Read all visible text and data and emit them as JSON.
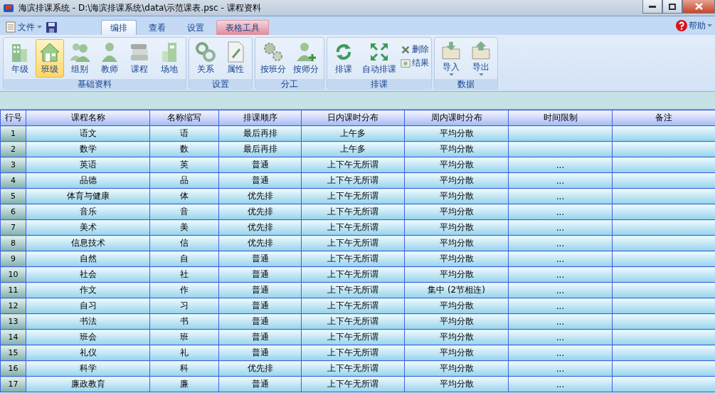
{
  "window": {
    "title": "海滨排课系统 - D:\\海滨排课系统\\data\\示范课表.psc - 课程资料"
  },
  "file_menu": {
    "label": "文件"
  },
  "help_menu": {
    "label": "帮助"
  },
  "tabs": [
    {
      "label": "编排",
      "selected": true,
      "kind": "normal"
    },
    {
      "label": "查看",
      "selected": false,
      "kind": "normal"
    },
    {
      "label": "设置",
      "selected": false,
      "kind": "normal"
    },
    {
      "label": "表格工具",
      "selected": false,
      "kind": "contextual"
    }
  ],
  "ribbon_groups": [
    {
      "title": "基础资料",
      "buttons": [
        {
          "label": "年级",
          "kind": "large",
          "selected": false
        },
        {
          "label": "班级",
          "kind": "large",
          "selected": true
        },
        {
          "label": "组别",
          "kind": "large",
          "selected": false
        },
        {
          "label": "教师",
          "kind": "large",
          "selected": false
        },
        {
          "label": "课程",
          "kind": "large",
          "selected": false
        },
        {
          "label": "场地",
          "kind": "large",
          "selected": false
        }
      ]
    },
    {
      "title": "设置",
      "buttons": [
        {
          "label": "关系",
          "kind": "large",
          "selected": false
        },
        {
          "label": "属性",
          "kind": "large",
          "selected": false
        }
      ]
    },
    {
      "title": "分工",
      "buttons": [
        {
          "label": "按班分",
          "kind": "large",
          "selected": false
        },
        {
          "label": "按师分",
          "kind": "large",
          "selected": false
        }
      ]
    },
    {
      "title": "排课",
      "buttons": [
        {
          "label": "排课",
          "kind": "large",
          "selected": false
        },
        {
          "label": "自动排课",
          "kind": "large",
          "selected": false
        },
        {
          "label": "删除",
          "kind": "small",
          "selected": false
        },
        {
          "label": "结果",
          "kind": "small",
          "selected": false
        }
      ]
    },
    {
      "title": "数据",
      "buttons": [
        {
          "label": "导入",
          "kind": "dropdown",
          "selected": false
        },
        {
          "label": "导出",
          "kind": "dropdown",
          "selected": false
        }
      ]
    }
  ],
  "table": {
    "columns": [
      "行号",
      "课程名称",
      "名称缩写",
      "排课顺序",
      "日内课时分布",
      "周内课时分布",
      "时间限制",
      "备注"
    ],
    "rows": [
      {
        "row": "1",
        "name": "语文",
        "abbr": "语",
        "order": "最后再排",
        "day": "上午多",
        "week": "平均分散"
      },
      {
        "row": "2",
        "name": "数学",
        "abbr": "数",
        "order": "最后再排",
        "day": "上午多",
        "week": "平均分散"
      },
      {
        "row": "3",
        "name": "英语",
        "abbr": "英",
        "order": "普通",
        "day": "上下午无所谓",
        "week": "平均分散",
        "limit": "..."
      },
      {
        "row": "4",
        "name": "品德",
        "abbr": "品",
        "order": "普通",
        "day": "上下午无所谓",
        "week": "平均分散",
        "limit": "..."
      },
      {
        "row": "5",
        "name": "体育与健康",
        "abbr": "体",
        "order": "优先排",
        "day": "上下午无所谓",
        "week": "平均分散",
        "limit": "..."
      },
      {
        "row": "6",
        "name": "音乐",
        "abbr": "音",
        "order": "优先排",
        "day": "上下午无所谓",
        "week": "平均分散",
        "limit": "..."
      },
      {
        "row": "7",
        "name": "美术",
        "abbr": "美",
        "order": "优先排",
        "day": "上下午无所谓",
        "week": "平均分散",
        "limit": "..."
      },
      {
        "row": "8",
        "name": "信息技术",
        "abbr": "信",
        "order": "优先排",
        "day": "上下午无所谓",
        "week": "平均分散",
        "limit": "..."
      },
      {
        "row": "9",
        "name": "自然",
        "abbr": "自",
        "order": "普通",
        "day": "上下午无所谓",
        "week": "平均分散",
        "limit": "..."
      },
      {
        "row": "10",
        "name": "社会",
        "abbr": "社",
        "order": "普通",
        "day": "上下午无所谓",
        "week": "平均分散",
        "limit": "..."
      },
      {
        "row": "11",
        "name": "作文",
        "abbr": "作",
        "order": "普通",
        "day": "上下午无所谓",
        "week": "集中 (2节相连)",
        "limit": "..."
      },
      {
        "row": "12",
        "name": "自习",
        "abbr": "习",
        "order": "普通",
        "day": "上下午无所谓",
        "week": "平均分散",
        "limit": "..."
      },
      {
        "row": "13",
        "name": "书法",
        "abbr": "书",
        "order": "普通",
        "day": "上下午无所谓",
        "week": "平均分散",
        "limit": "..."
      },
      {
        "row": "14",
        "name": "班会",
        "abbr": "班",
        "order": "普通",
        "day": "上下午无所谓",
        "week": "平均分散",
        "limit": "..."
      },
      {
        "row": "15",
        "name": "礼仪",
        "abbr": "礼",
        "order": "普通",
        "day": "上下午无所谓",
        "week": "平均分散",
        "limit": "..."
      },
      {
        "row": "16",
        "name": "科学",
        "abbr": "科",
        "order": "优先排",
        "day": "上下午无所谓",
        "week": "平均分散",
        "limit": "..."
      },
      {
        "row": "17",
        "name": "廉政教育",
        "abbr": "廉",
        "order": "普通",
        "day": "上下午无所谓",
        "week": "平均分散",
        "limit": "..."
      }
    ]
  }
}
